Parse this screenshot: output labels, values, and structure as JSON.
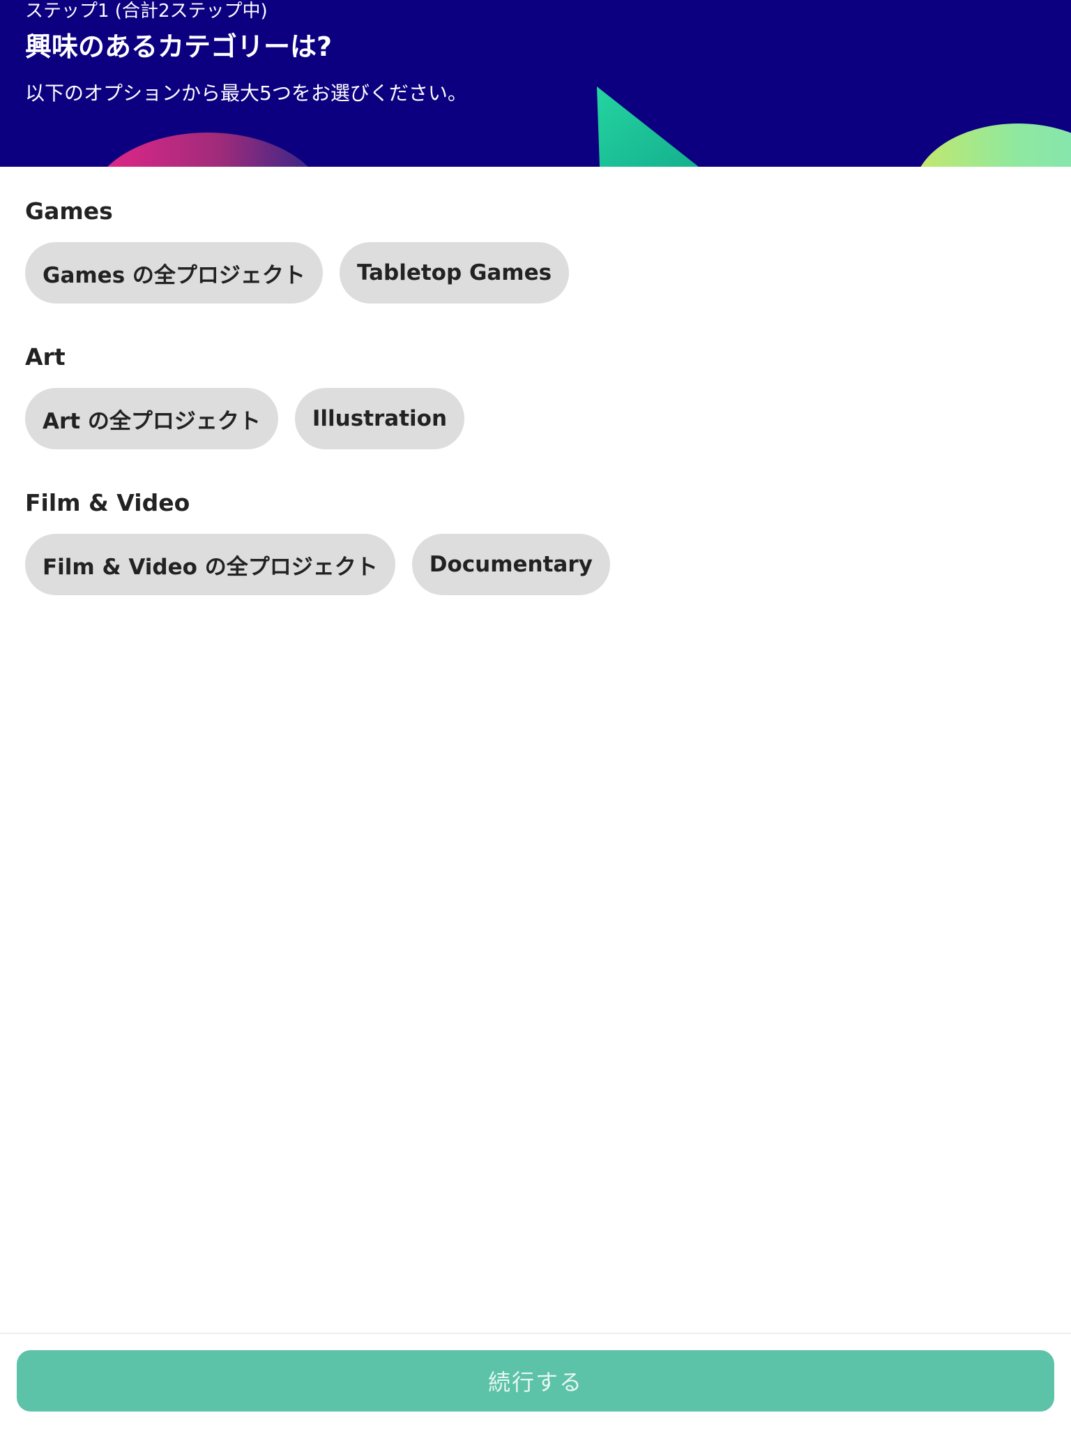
{
  "header": {
    "step": "ステップ1 (合計2ステップ中)",
    "title": "興味のあるカテゴリーは?",
    "subtitle": "以下のオプションから最大5つをお選びください。"
  },
  "sections": [
    {
      "heading": "Games",
      "chips": [
        "Games の全プロジェクト",
        "Tabletop Games"
      ]
    },
    {
      "heading": "Art",
      "chips": [
        "Art の全プロジェクト",
        "Illustration"
      ]
    },
    {
      "heading": "Film & Video",
      "chips": [
        "Film & Video の全プロジェクト",
        "Documentary"
      ]
    }
  ],
  "footer": {
    "continue_label": "続行する"
  },
  "colors": {
    "banner": "#0d0080",
    "chip": "#dcdddc",
    "button": "#5cc2a8"
  }
}
